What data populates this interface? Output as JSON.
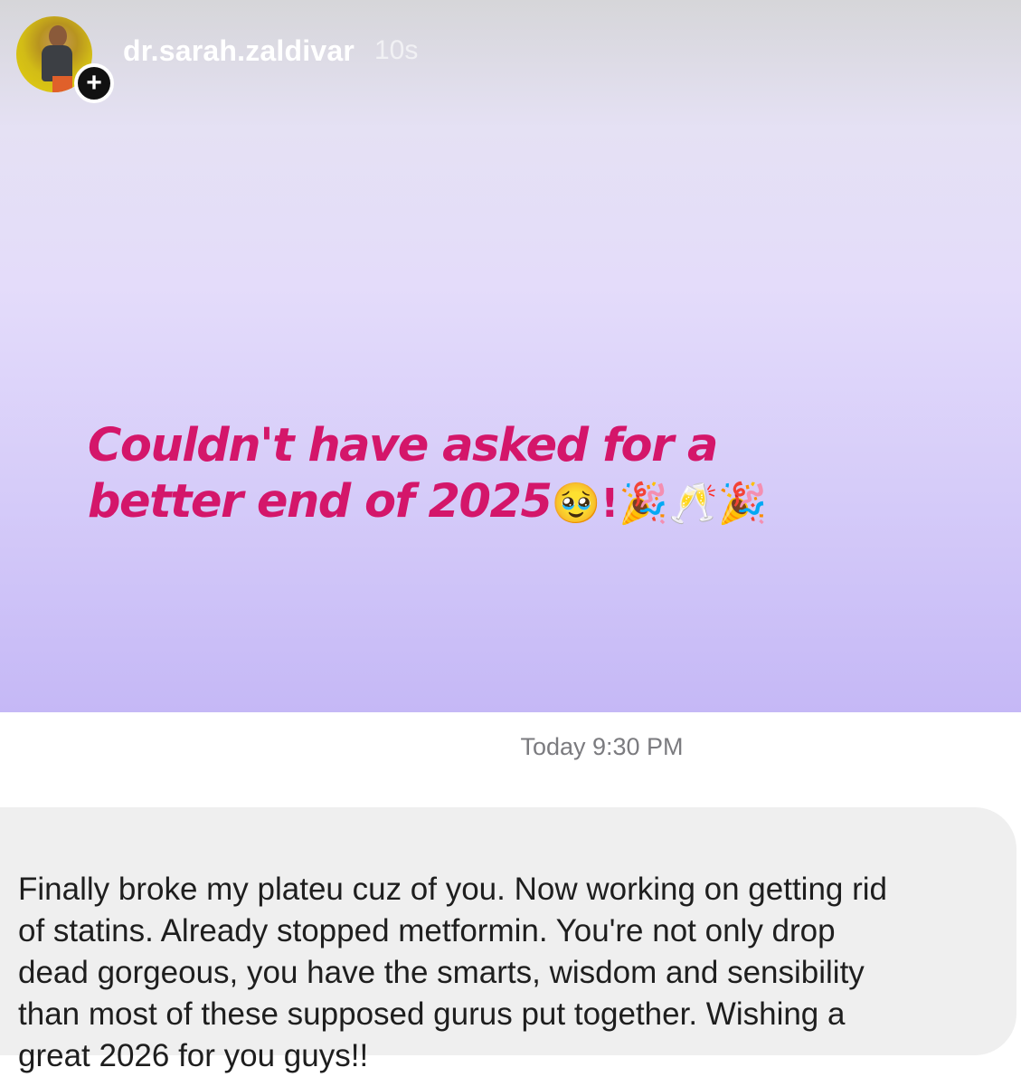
{
  "story": {
    "username": "dr.sarah.zaldivar",
    "time_ago": "10s",
    "plus_symbol": "+",
    "caption_line1": "Couldn't have asked for a",
    "caption_line2_text": "better end of 2025",
    "caption_line2_emojis": "🥹!🎉🥂🎉",
    "caption_color": "#d4166a",
    "avatar_icon": "profile-avatar",
    "add_icon": "plus-icon"
  },
  "message": {
    "timestamp": "Today 9:30 PM",
    "text": "Finally broke my plateu cuz of you. Now working on getting rid\nof statins. Already stopped metformin. You're not only drop\ndead gorgeous, you have the smarts,  wisdom and sensibility\nthan most of these supposed gurus put together. Wishing a\ngreat 2026 for you guys!!",
    "bubble_color": "#efefef"
  }
}
